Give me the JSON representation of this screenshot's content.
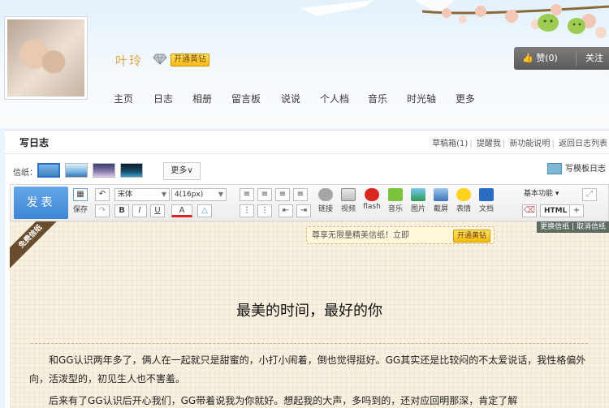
{
  "profile": {
    "username": "叶玲",
    "vip_label": "开通黄钻",
    "like_label": "赞(0)",
    "follow_label": "关注"
  },
  "nav": [
    "主页",
    "日志",
    "相册",
    "留言板",
    "说说",
    "个人档",
    "音乐",
    "时光轴",
    "更多"
  ],
  "editor": {
    "page_title": "写日志",
    "top_links": [
      "草稿箱(1)",
      "提醒我",
      "新功能说明",
      "返回日志列表"
    ],
    "paper_label": "信纸：",
    "paper_more": "更多∨",
    "write_old": "写模板日志",
    "publish_label": "发表",
    "save_label": "保存",
    "font_name": "宋体",
    "font_size": "4(16px)",
    "tools": [
      "链接",
      "视频",
      "flash",
      "音乐",
      "图片",
      "截屏",
      "表情",
      "文档"
    ],
    "basic_features": "基本功能",
    "html_label": "HTML",
    "bold": "B",
    "italic": "I",
    "underline": "U",
    "color": "A"
  },
  "content": {
    "ribbon": "免费信纸",
    "promo_text": "尊享无限量精美信纸！立即",
    "promo_bold": "无限量",
    "promo_button": "开通黄钻",
    "paper_actions": "更换信纸 | 取消信纸",
    "article_title": "最美的时间，最好的你",
    "paragraph1": "和GG认识两年多了，俩人在一起就只是甜蜜的，小打小闹着，倒也觉得挺好。GG其实还是比较闷的不太爱说话，我性格偏外向，活泼型的，初见生人也不害羞。",
    "paragraph2": "后来有了GG认识后开心我们，GG带着说我为你就好。想起我的大声，多吗到的，还对应回明那深，肯定了解"
  },
  "colors": {
    "accent": "#3d86d3",
    "vip": "#f5ba0d",
    "paper_bg": "#f8f1e1",
    "username": "#e0a44c"
  }
}
